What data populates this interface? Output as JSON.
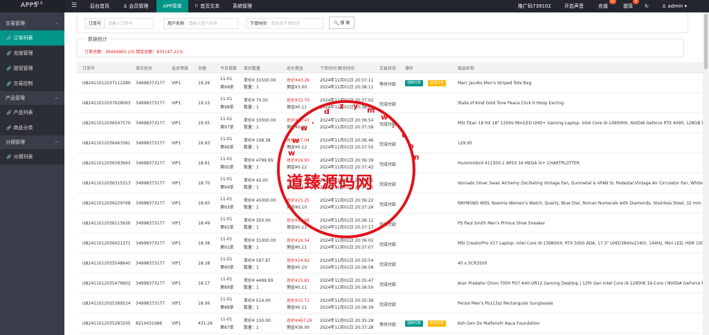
{
  "app": {
    "title": "APPS",
    "version": "V1.0"
  },
  "topnav": {
    "items": [
      "后台首页",
      "会员管理",
      "APP菜单",
      "首页文本",
      "系统管理"
    ],
    "active": 2,
    "invite": "推广码739102",
    "sound": "开启声音",
    "recharge": "充值",
    "recharge_badge": "51",
    "withdraw": "提现",
    "withdraw_badge": "8",
    "user": "admin"
  },
  "sidebar": {
    "groups": [
      {
        "label": "交易管理",
        "items": [
          "订单列表",
          "充值管理",
          "提现管理",
          "交易控制"
        ]
      },
      {
        "label": "产品管理",
        "items": [
          "产品列表",
          "商品分类"
        ]
      },
      {
        "label": "分佣管理",
        "items": [
          "分佣列表"
        ]
      }
    ]
  },
  "filters": {
    "order_no_label": "订单号",
    "order_no_placeholder": "请输入订单号",
    "username_label": "用户名称",
    "username_placeholder": "请输入用户名称",
    "time_label": "下单时间",
    "time_placeholder": "请选择下单时间",
    "search_label": "搜 索"
  },
  "stats": {
    "title": "数据统计",
    "text": "订单总额：36469965.2元   佣金总额：833187.22元"
  },
  "table": {
    "headers": [
      "订单号",
      "真实姓名",
      "会员等级",
      "余额",
      "今日单数",
      "单价数量",
      "总价佣金",
      "下单时间 解冻时间",
      "交易状态",
      "操作",
      "商品名称"
    ],
    "rows": [
      {
        "no": "UB2411012037112280",
        "name": "34998373177",
        "level": "VIP1",
        "bal": "19.26",
        "d1": "11-01",
        "d2": "第99单",
        "p1": "单价¥ 31500.00",
        "p2": "数量：1",
        "t1": "总价¥43.26",
        "t2": "佣金¥3.00",
        "time1": "2024年11月01日 20:37:11",
        "time2": "2024年11月01日 20:38:11",
        "status": "等待付款",
        "ops": true,
        "product": "Marc Jacobs Men's Striped Tote Bag"
      },
      {
        "no": "UB2411012037028063",
        "name": "34998373177",
        "level": "VIP1",
        "bal": "19.15",
        "d1": "11-01",
        "d2": "第98单",
        "p1": "单价¥ 70.00",
        "p2": "数量：1",
        "t1": "总价¥15.70",
        "t2": "佣金¥0.11",
        "time1": "2024年11月01日 20:37:02",
        "time2": "2024年11月01日 20:38:01",
        "status": "完成付款",
        "ops": false,
        "product": "State of Kind Gold Tone Peace Click It Hoop Earring"
      },
      {
        "no": "UB2411012036547570",
        "name": "34998373177",
        "level": "VIP1",
        "bal": "19.05",
        "d1": "11-01",
        "d2": "第97单",
        "p1": "单价¥ 33000.00",
        "p2": "数量：1",
        "t1": "总价¥13.43",
        "t2": "佣金¥0.10",
        "time1": "2024年11月01日 20:36:54",
        "time2": "2024年11月01日 20:37:58",
        "status": "完成付款",
        "ops": false,
        "product": "MSI Titan 18 HX 18\" 120Hz MiniLED UHD+ Gaming Laptop: Intel Core i9-14900HX, NVIDIA Geforce RTX 4090, 128GB DDR5,"
      },
      {
        "no": "UB2411012036463361",
        "name": "34998373177",
        "level": "VIP1",
        "bal": "18.93",
        "d1": "11-01",
        "d2": "第96单",
        "p1": "单价¥ 198.38",
        "p2": "数量：1",
        "t1": "总价¥17.04",
        "t2": "佣金¥0.12",
        "time1": "2024年11月01日 20:36:46",
        "time2": "2024年11月01日 20:37:50",
        "status": "完成付款",
        "ops": false,
        "product": "129.95"
      },
      {
        "no": "UB2411012036393663",
        "name": "34998373177",
        "level": "VIP1",
        "bal": "18.81",
        "d1": "11-01",
        "d2": "第95单",
        "p1": "单价¥ 4799.99",
        "p2": "数量：1",
        "t1": "总价¥16.93",
        "t2": "佣金¥0.12",
        "time1": "2024年11月01日 20:36:39",
        "time2": "2024年11月01日 20:37:42",
        "status": "完成付款",
        "ops": false,
        "product": "Humminbird 411500-1 APEX 16 MEGA SI+ CHARTPLOTTER"
      },
      {
        "no": "UB2411012036315313",
        "name": "34998373177",
        "level": "VIP1",
        "bal": "18.70",
        "d1": "11-01",
        "d2": "第94单",
        "p1": "单价¥ 43.00",
        "p2": "数量：1",
        "t1": "总价¥15.41",
        "t2": "佣金¥0.11",
        "time1": "2024年11月01日 20:36:31",
        "time2": "2024年11月01日 20:37:35",
        "status": "完成付款",
        "ops": false,
        "product": "Vornado Silver Swan Alchemy Oscillating Vintage Fan, Gunmetal & VFAN Sr. Pedestal Vintage Air Circulator Fan, White Wh"
      },
      {
        "no": "UB2411012036229768",
        "name": "34998373177",
        "level": "VIP1",
        "bal": "18.60",
        "d1": "11-01",
        "d2": "第93单",
        "p1": "单价¥ 45000.00",
        "p2": "数量：1",
        "t1": "总价¥15.25",
        "t2": "佣金¥0.10",
        "time1": "2024年11月01日 20:36:22",
        "time2": "2024年11月01日 20:37:26",
        "status": "完成付款",
        "ops": false,
        "product": "RAYMOND WEIL Noemia Women's Watch, Quartz, Blue Dial, Roman Numerals with Diamonds, Stainless Steel, 32 mm"
      },
      {
        "no": "UB2411012036115626",
        "name": "34998373177",
        "level": "VIP1",
        "bal": "18.49",
        "d1": "11-01",
        "d2": "第92单",
        "p1": "单价¥ 350.00",
        "p2": "数量：1",
        "t1": "总价¥14.68",
        "t2": "佣金¥0.11",
        "time1": "2024年11月01日 20:36:11",
        "time2": "2024年11月01日 20:37:17",
        "status": "完成付款",
        "ops": false,
        "product": "PS Paul Smith Men's Primus Shoe Sneaker"
      },
      {
        "no": "UB2411012036021371",
        "name": "34998373177",
        "level": "VIP1",
        "bal": "18.38",
        "d1": "11-01",
        "d2": "第91单",
        "p1": "单价¥ 31000.00",
        "p2": "数量：1",
        "t1": "总价¥16.54",
        "t2": "佣金¥0.11",
        "time1": "2024年11月01日 20:36:02",
        "time2": "2024年11月01日 20:37:07",
        "status": "完成付款",
        "ops": false,
        "product": "MSI CreatorPro X17 Laptop: Intel Core i9-13980HX, RTX 5000 ADA, 17.3\" UHD(3840x2160), 144Hz, Mini LED, HDR 1000, Pan"
      },
      {
        "no": "UB2411012035548645",
        "name": "34998373177",
        "level": "VIP1",
        "bal": "18.28",
        "d1": "11-01",
        "d2": "第90单",
        "p1": "单价¥ 597.97",
        "p2": "数量：1",
        "t1": "总价¥14.62",
        "t2": "佣金¥0.10",
        "time1": "2024年11月01日 20:35:54",
        "time2": "2024年11月01日 20:36:58",
        "status": "完成付款",
        "ops": false,
        "product": "40 x SCR3500"
      },
      {
        "no": "UB2411012035476602",
        "name": "34998373177",
        "level": "VIP1",
        "bal": "18.17",
        "d1": "11-01",
        "d2": "第89单",
        "p1": "单价¥ 4499.99",
        "p2": "数量：1",
        "t1": "总价¥15.81",
        "t2": "佣金¥0.11",
        "time1": "2024年11月01日 20:35:47",
        "time2": "2024年11月01日 20:36:50",
        "status": "完成付款",
        "ops": false,
        "product": "Acer Predator Orion 7000 PO7-640-UR12 Gaming Desktop | 12th Gen Intel Core i9-12900K 16-Core | NVIDIA GeForce RTX 3"
      },
      {
        "no": "UB2411012035369524",
        "name": "34998373177",
        "level": "VIP1",
        "bal": "18.06",
        "d1": "11-01",
        "d2": "第88单",
        "p1": "单价¥ 514.00",
        "p2": "数量：1",
        "t1": "总价¥15.71",
        "t2": "佣金¥0.11",
        "time1": "2024年11月01日 20:35:36",
        "time2": "2024年11月01日 20:36:39",
        "status": "完成付款",
        "ops": false,
        "product": "Persol Men's Po113sz Rectangular Sunglasses"
      },
      {
        "no": "UB2411012035283205",
        "name": "8210431686",
        "level": "VIP1",
        "bal": "431.26",
        "d1": "11-01",
        "d2": "第87单",
        "p1": "单价¥ 150.00",
        "p2": "数量：1",
        "t1": "总价¥467.26",
        "t2": "佣金¥36.00",
        "time1": "2024年11月01日 20:35:28",
        "time2": "2024年11月01日 20:37:28",
        "status": "等待付款",
        "ops": true,
        "product": "Koh Gen Do Maifanshi Aqua Foundation"
      }
    ],
    "op_pay": "强制付款",
    "op_cancel": "取消订单"
  },
  "watermark": {
    "big": "道臻源码网",
    "letters": [
      "w",
      "w",
      "w",
      ".",
      "d",
      "z",
      "y",
      "m",
      "w",
      ".",
      "c",
      "o",
      "m"
    ]
  }
}
